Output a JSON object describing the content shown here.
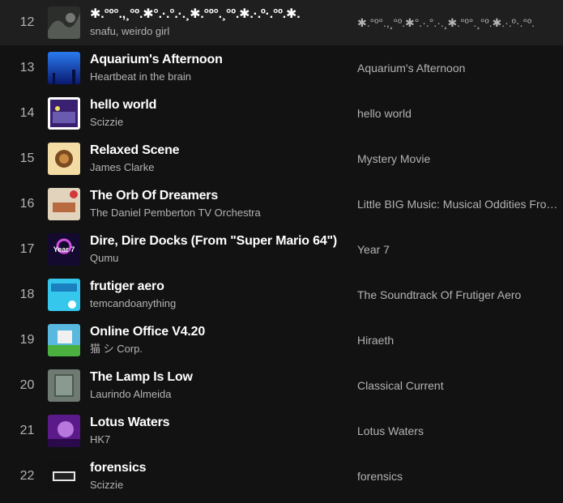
{
  "tracks": [
    {
      "num": "12",
      "title": "✱.°º°.,¸°º.✱°.·.°.·.¸✱.°º°.¸°º.✱.·.º·.°º.✱.",
      "artist": "snafu, weirdo girl",
      "album": "✱.°º°.,¸°º.✱°.·.°.·.¸✱.°º°.¸°º.✱.·.º·.°º.",
      "cover": "#3a3d3a"
    },
    {
      "num": "13",
      "title": "Aquarium's Afternoon",
      "artist": "Heartbeat in the brain",
      "album": "Aquarium's Afternoon",
      "cover": "#1a4fd6"
    },
    {
      "num": "14",
      "title": "hello world",
      "artist": "Scizzie",
      "album": "hello world",
      "cover": "#4a2a8a"
    },
    {
      "num": "15",
      "title": "Relaxed Scene",
      "artist": "James Clarke",
      "album": "Mystery Movie",
      "cover": "#f2d9a0"
    },
    {
      "num": "16",
      "title": "The Orb Of Dreamers",
      "artist": "The Daniel Pemberton TV Orchestra",
      "album": "Little BIG Music: Musical Oddities From...",
      "cover": "#d8c8b0"
    },
    {
      "num": "17",
      "title": "Dire, Dire Docks (From \"Super Mario 64\")",
      "artist": "Qumu",
      "album": "Year 7",
      "cover": "#1a0f3a",
      "badge": "Year 7"
    },
    {
      "num": "18",
      "title": "frutiger aero",
      "artist": "temcandoanything",
      "album": "The Soundtrack Of Frutiger Aero",
      "cover": "#2ec4e8"
    },
    {
      "num": "19",
      "title": "Online Office V4.20",
      "artist": "猫 シ Corp.",
      "album": "Hiraeth",
      "cover": "#3aa0d0"
    },
    {
      "num": "20",
      "title": "The Lamp Is Low",
      "artist": "Laurindo Almeida",
      "album": "Classical Current",
      "cover": "#5a6a60"
    },
    {
      "num": "21",
      "title": "Lotus Waters",
      "artist": "HK7",
      "album": "Lotus Waters",
      "cover": "#7a2ab0"
    },
    {
      "num": "22",
      "title": "forensics",
      "artist": "Scizzie",
      "album": "forensics",
      "cover": "#1a1a1a"
    }
  ]
}
